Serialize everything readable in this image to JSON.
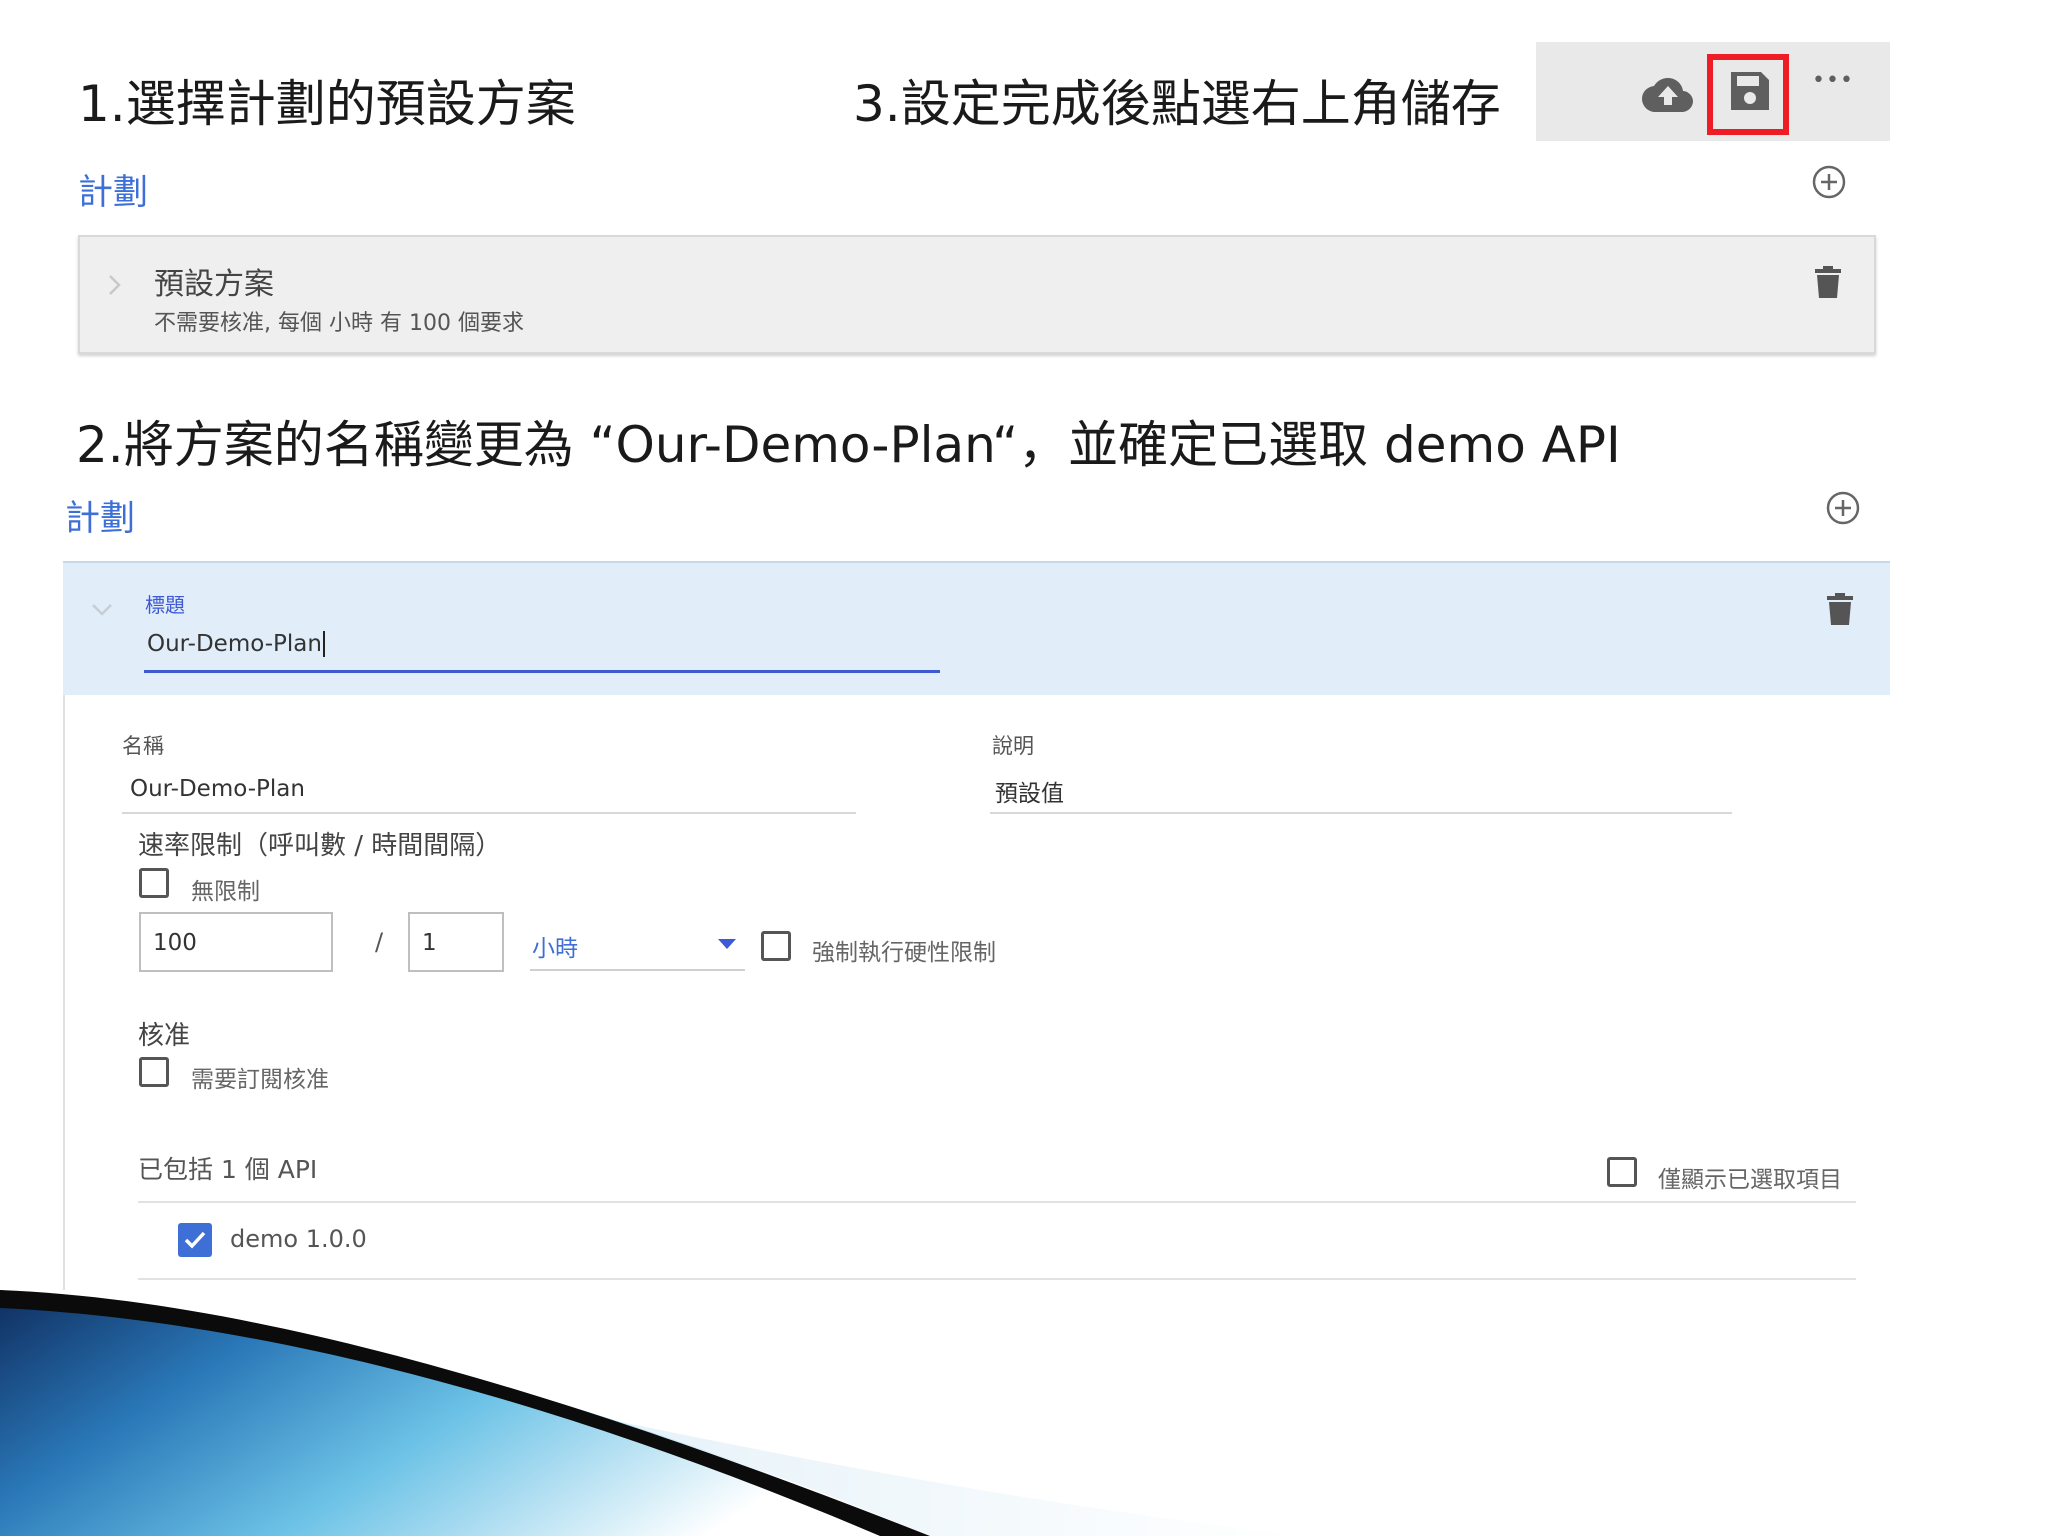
{
  "steps": {
    "step1": "1.選擇計劃的預設方案",
    "step2": "2.將方案的名稱變更為 “Our-Demo-Plan“，並確定已選取 demo API",
    "step3": "3.設定完成後點選右上角儲存"
  },
  "toolbar": {
    "icons": [
      "cloud-upload-icon",
      "save-icon",
      "more-icon"
    ],
    "more_label": "•••",
    "highlight_color": "#ee1c24"
  },
  "top_panel": {
    "section_title": "計劃",
    "plan": {
      "name": "預設方案",
      "summary": "不需要核准, 每個 小時 有 100 個要求"
    }
  },
  "bottom_panel": {
    "section_title": "計劃",
    "title_label": "標題",
    "title_value": "Our-Demo-Plan",
    "name_label": "名稱",
    "name_value": "Our-Demo-Plan",
    "description_label": "說明",
    "description_value": "預設值",
    "rate_limit_label": "速率限制（呼叫數 / 時間間隔）",
    "unlimited_label": "無限制",
    "unlimited_checked": false,
    "calls_value": "100",
    "slash": "/",
    "interval_value": "1",
    "interval_unit": "小時",
    "hard_limit_label": "強制執行硬性限制",
    "hard_limit_checked": false,
    "approval_label": "核准",
    "require_approval_label": "需要訂閱核准",
    "require_approval_checked": false,
    "api_included_label": "已包括 1 個 API",
    "show_selected_only_label": "僅顯示已選取項目",
    "show_selected_only_checked": false,
    "apis": [
      {
        "name": "demo 1.0.0",
        "checked": true
      }
    ]
  },
  "colors": {
    "accent": "#3d6fd6",
    "header_bg": "#e1edf9",
    "checkbox_checked": "#3d6fd6",
    "focus_underline": "#3d59d4"
  }
}
